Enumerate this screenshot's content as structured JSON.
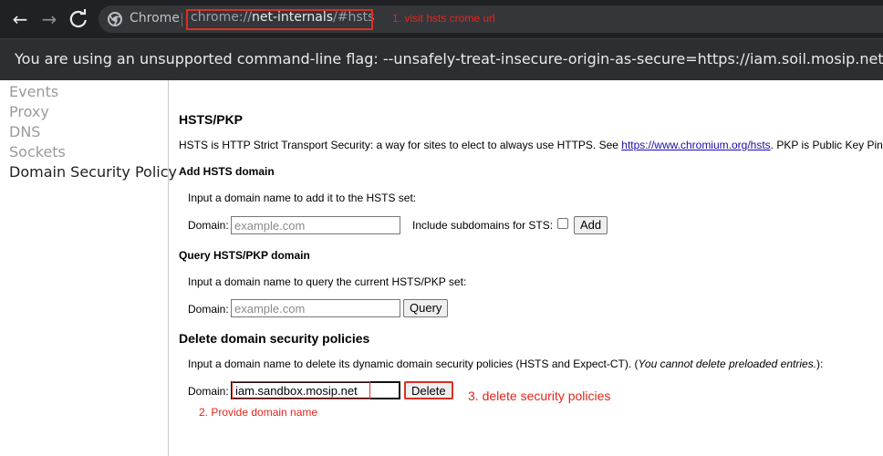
{
  "browser": {
    "site_name": "Chrome",
    "url_scheme": "chrome://",
    "url_host": "net-internals",
    "url_path": "/#hsts"
  },
  "annotations": {
    "step1": "1.  visit hsts crome url",
    "step2": "2. Provide domain name",
    "step3": "3. delete security policies",
    "color": "#e3261c"
  },
  "infobar": {
    "message": "You are using an unsupported command-line flag: --unsafely-treat-insecure-origin-as-secure=https://iam.soil.mosip.net,https://admin.s"
  },
  "sidebar": {
    "items": [
      "Events",
      "Proxy",
      "DNS",
      "Sockets",
      "Domain Security Policy"
    ],
    "active": "Domain Security Policy"
  },
  "hsts": {
    "title": "HSTS/PKP",
    "intro_prefix": "HSTS is HTTP Strict Transport Security: a way for sites to elect to always use HTTPS. See ",
    "intro_link": "https://www.chromium.org/hsts",
    "intro_suffix": ". PKP is Public Key Pinni",
    "add": {
      "heading": "Add HSTS domain",
      "description": "Input a domain name to add it to the HSTS set:",
      "domain_label": "Domain:",
      "placeholder": "example.com",
      "subdomains_label": "Include subdomains for STS:",
      "button": "Add"
    },
    "query": {
      "heading": "Query HSTS/PKP domain",
      "description": "Input a domain name to query the current HSTS/PKP set:",
      "domain_label": "Domain:",
      "placeholder": "example.com",
      "button": "Query"
    },
    "delete": {
      "heading": "Delete domain security policies",
      "description_prefix": "Input a domain name to delete its dynamic domain security policies (HSTS and Expect-CT). (",
      "description_italic": "You cannot delete preloaded entries.",
      "description_suffix": "):",
      "domain_label": "Domain:",
      "value": "iam.sandbox.mosip.net",
      "button": "Delete"
    }
  }
}
